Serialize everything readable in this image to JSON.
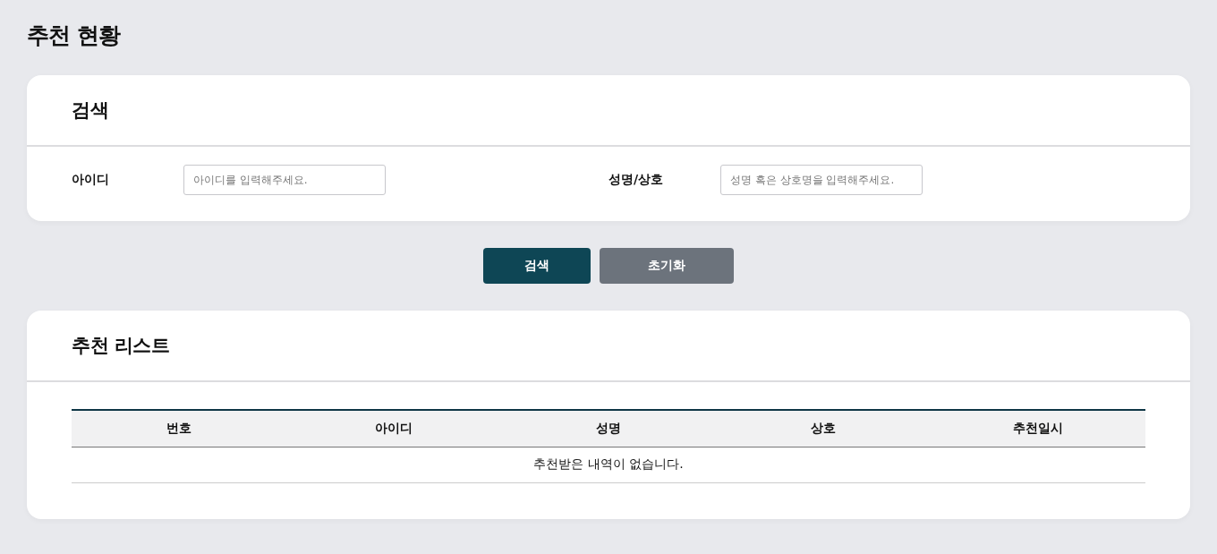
{
  "page_title": "추천 현황",
  "search_panel": {
    "title": "검색",
    "fields": [
      {
        "label": "아이디",
        "placeholder": "아이디를 입력해주세요."
      },
      {
        "label": "성명/상호",
        "placeholder": "성명 혹은 상호명을 입력해주세요."
      }
    ]
  },
  "buttons": [
    {
      "label": "검색",
      "kind": "primary"
    },
    {
      "label": "초기화",
      "kind": "secondary"
    }
  ],
  "list_panel": {
    "title": "추천 리스트",
    "table": {
      "columns": [
        "번호",
        "아이디",
        "성명",
        "상호",
        "추천일시"
      ],
      "empty_message": "추천받은 내역이 없습니다."
    }
  }
}
